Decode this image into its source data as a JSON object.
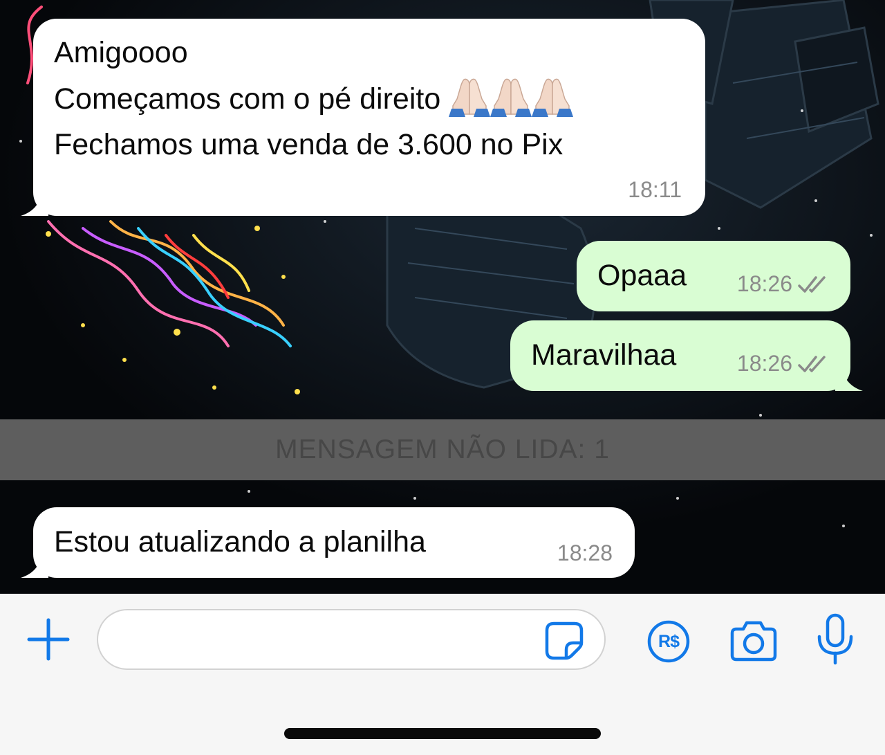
{
  "colors": {
    "accent": "#1279e8",
    "incoming_bubble": "#ffffff",
    "outgoing_bubble": "#d9fdd3",
    "wallpaper": "#05070a",
    "read_ticks": "#8a8a8a"
  },
  "messages": [
    {
      "direction": "incoming",
      "lines": [
        "Amigoooo",
        "Começamos com o pé direito",
        "Fechamos uma venda de 3.600 no Pix"
      ],
      "emoji": [
        "folded-hands",
        "folded-hands",
        "folded-hands"
      ],
      "time": "18:11"
    },
    {
      "direction": "outgoing",
      "text": "Opaaa",
      "time": "18:26",
      "status": "delivered"
    },
    {
      "direction": "outgoing",
      "text": "Maravilhaa",
      "time": "18:26",
      "status": "delivered"
    },
    {
      "direction": "incoming",
      "text": "Estou atualizando a planilha",
      "time": "18:28"
    }
  ],
  "unread_divider": {
    "label": "MENSAGEM NÃO LIDA: 1"
  },
  "composer": {
    "input_value": "",
    "icons": [
      "plus-icon",
      "sticker-icon",
      "pix-payment-icon",
      "camera-icon",
      "microphone-icon"
    ],
    "pix_label": "R$"
  }
}
